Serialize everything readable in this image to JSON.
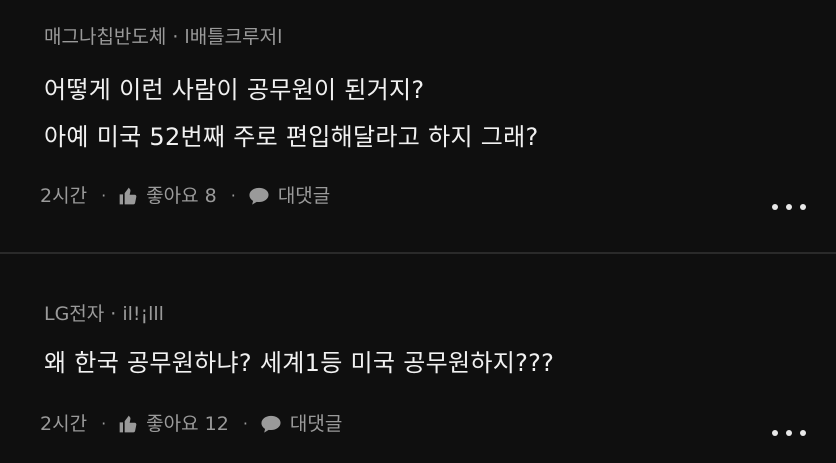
{
  "comments": [
    {
      "author": "매그나칩반도체",
      "handle": "l배틀크루저l",
      "lines": [
        "어떻게 이런 사람이 공무원이 된거지?",
        "아예 미국 52번째 주로 편입해달라고 하지 그래?"
      ],
      "time": "2시간",
      "like_label": "좋아요 8",
      "reply_label": "대댓글"
    },
    {
      "author": "LG전자",
      "handle": "il!¡lll",
      "lines": [
        "왜 한국 공무원하냐? 세계1등 미국 공무원하지???"
      ],
      "time": "2시간",
      "like_label": "좋아요 12",
      "reply_label": "대댓글"
    }
  ],
  "separator": "·",
  "icons": {
    "like": "thumbs-up-icon",
    "reply": "speech-bubble-icon",
    "more": "more-dots-icon"
  },
  "colors": {
    "background": "#0f0f0f",
    "text": "#f1f1f1",
    "meta": "#9a9a9a",
    "divider": "#2a2a2a"
  }
}
